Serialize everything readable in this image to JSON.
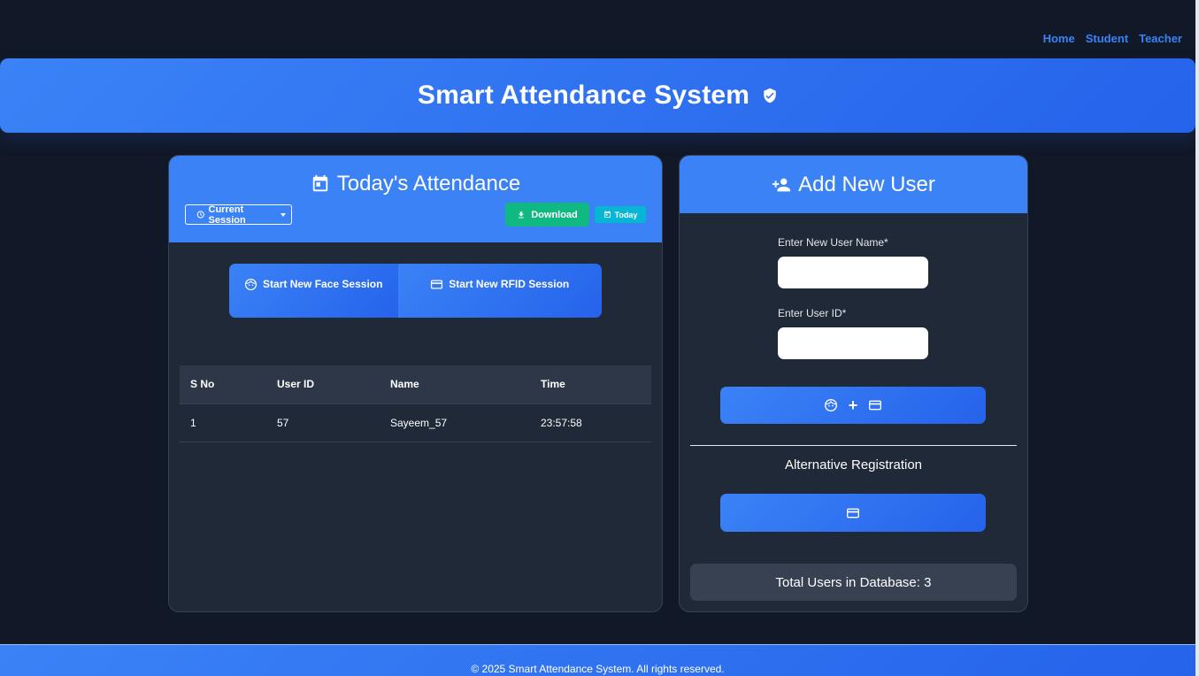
{
  "nav": {
    "home": "Home",
    "student": "Student",
    "teacher": "Teacher"
  },
  "header": {
    "title": "Smart Attendance System",
    "icon": "shield-check-icon"
  },
  "attendance": {
    "title": "Today's Attendance",
    "session_select": "Current Session",
    "download_label": "Download",
    "today_label": "Today",
    "face_session_label": "Start New Face Session",
    "rfid_session_label": "Start New RFID Session",
    "columns": [
      "S No",
      "User ID",
      "Name",
      "Time"
    ],
    "rows": [
      {
        "sno": "1",
        "user_id": "57",
        "name": "Sayeem_57",
        "time": "23:57:58"
      }
    ]
  },
  "add_user": {
    "title": "Add New User",
    "name_label": "Enter New User Name*",
    "id_label": "Enter User ID*",
    "combo_plus": "+",
    "alt_heading": "Alternative Registration",
    "total_users": "Total Users in Database: 3"
  },
  "footer": {
    "text": "© 2025 Smart Attendance System. All rights reserved."
  },
  "colors": {
    "accent": "#3b82f6",
    "success": "#10b981",
    "info": "#06b6d4",
    "background": "#111827",
    "card": "#1f2937"
  }
}
